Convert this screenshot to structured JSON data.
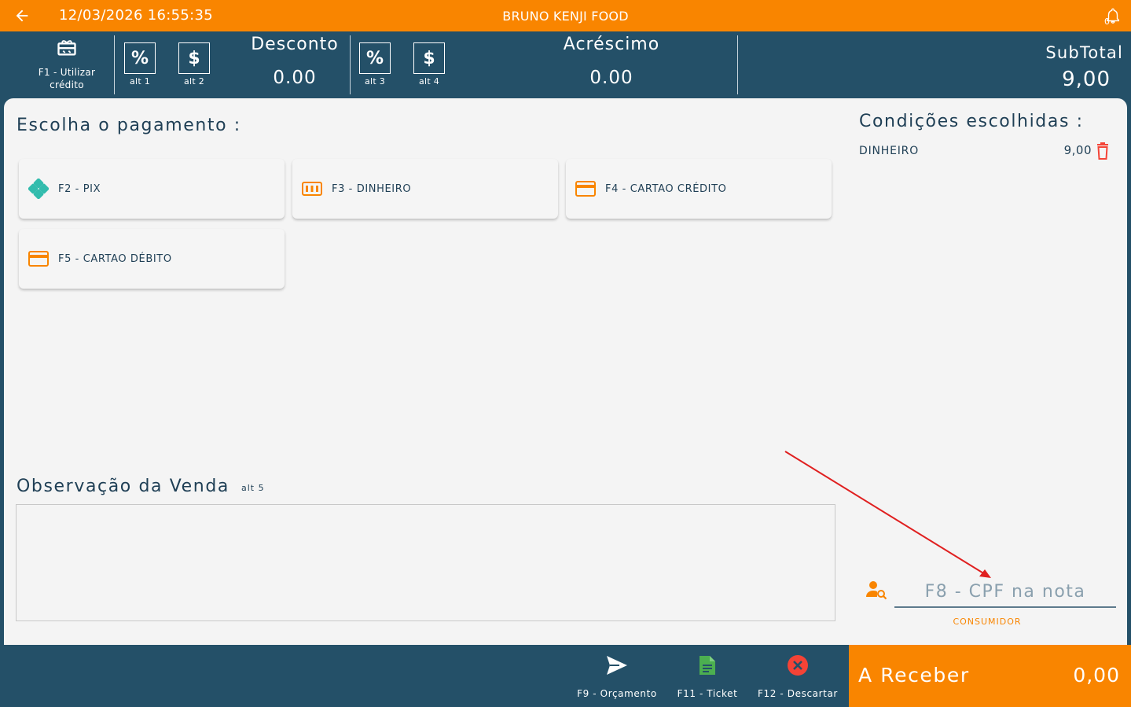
{
  "topbar": {
    "datetime": "12/03/2026 16:55:35",
    "store_name": "BRUNO KENJI FOOD",
    "notification_count": "0",
    "back_icon": "arrow-left-icon",
    "bell_icon": "bell-icon"
  },
  "header": {
    "credit_label": "F1 -  Utilizar crédito",
    "credit_icon": "gift-card-icon",
    "desconto": {
      "title": "Desconto",
      "value": "0.00",
      "percent_alt": "alt 1",
      "money_alt": "alt 2"
    },
    "acrescimo": {
      "title": "Acréscimo",
      "value": "0.00",
      "percent_alt": "alt 3",
      "money_alt": "alt 4"
    },
    "percent_symbol": "%",
    "money_symbol": "$",
    "subtotal_label": "SubTotal",
    "subtotal_value": "9,00"
  },
  "payment": {
    "title": "Escolha o pagamento :",
    "options": [
      {
        "label": "F2 - PIX",
        "icon": "pix-icon"
      },
      {
        "label": "F3 - DINHEIRO",
        "icon": "cash-icon"
      },
      {
        "label": "F4 - CARTAO CRÉDITO",
        "icon": "credit-card-icon"
      },
      {
        "label": "F5 - CARTAO DÉBITO",
        "icon": "debit-card-icon"
      }
    ]
  },
  "conditions": {
    "title": "Condições escolhidas :",
    "items": [
      {
        "name": "DINHEIRO",
        "value": "9,00"
      }
    ]
  },
  "observation": {
    "title": "Observação da Venda",
    "alt": "alt 5",
    "value": ""
  },
  "consumer": {
    "cpf_placeholder": "F8 - CPF na nota",
    "label": "CONSUMIDOR",
    "icon": "user-search-icon"
  },
  "footer": {
    "orcamento": "F9 - Orçamento",
    "ticket": "F11 - Ticket",
    "descartar": "F12 - Descartar",
    "receive_label": "A Receber",
    "receive_value": "0,00"
  },
  "colors": {
    "orange": "#f98500",
    "navy": "#245068",
    "pix_teal": "#32bcad",
    "ticket_green": "#4caf50",
    "discard_red": "#f44336",
    "arrow_red": "#e02020"
  }
}
